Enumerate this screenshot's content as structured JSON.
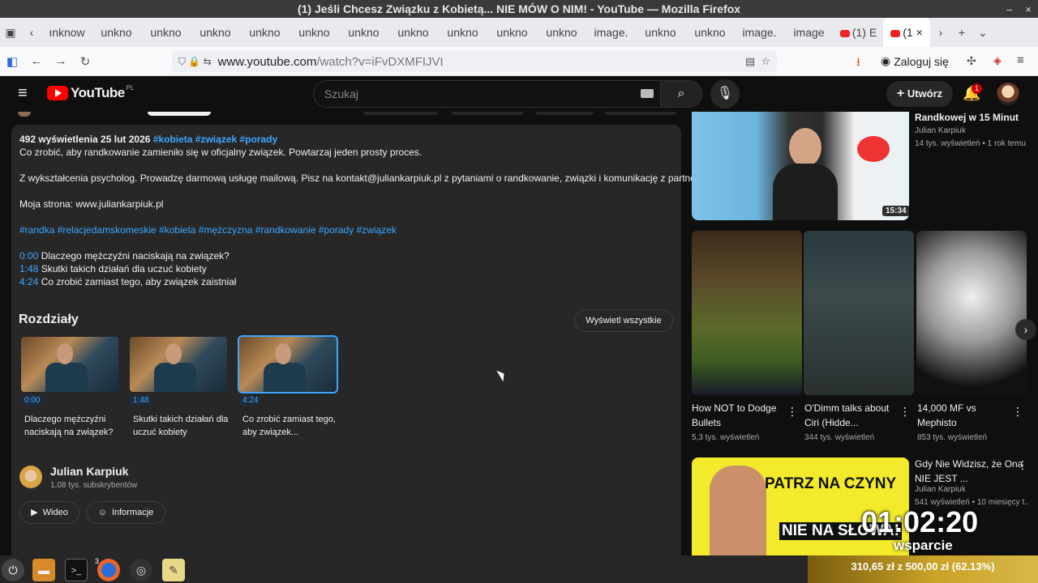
{
  "window": {
    "title": "(1) Jeśli Chcesz Związku z Kobietą... NIE MÓW O NIM! - YouTube — Mozilla Firefox",
    "minimize": "–",
    "close": "×"
  },
  "tabs": [
    "ınknow",
    "unkno",
    "unkno",
    "unkno",
    "unkno",
    "unkno",
    "unkno",
    "unkno",
    "unkno",
    "unkno",
    "unkno",
    "image.",
    "unkno",
    "unkno",
    "image.",
    "image",
    "image",
    "(1) E",
    "(1"
  ],
  "nav": {
    "url_host": "www.youtube.com",
    "url_path": "/watch?v=iFvDXMFIJVI",
    "login_label": "Zaloguj się"
  },
  "yt_header": {
    "logo": "YouTube",
    "region": "PL",
    "search_placeholder": "Szukaj",
    "create_label": "Utwórz",
    "notif_count": "1"
  },
  "description": {
    "stats": "492 wyświetlenia  25 lut 2026",
    "stat_tags": "#kobieta #związek #porady",
    "line1": "Co zrobić, aby randkowanie zamieniło się w oficjalny związek. Powtarzaj jeden prosty proces.",
    "line2": "Z wykształcenia psycholog. Prowadzę darmową usługę mailową. Pisz na kontakt@juliankarpiuk.pl z pytaniami o randkowanie, związki i komunikację z partnerem.",
    "line3": "Moja strona: www.juliankarpiuk.pl",
    "hashtags": "#randka #relacjedamskomeskie #kobieta #mężczyzna #randkowanie #porady #związek",
    "timestamps": [
      {
        "time": "0:00",
        "text": "Dlaczego mężczyźni naciskają na związek?"
      },
      {
        "time": "1:48",
        "text": "Skutki takich działań dla uczuć kobiety"
      },
      {
        "time": "4:24",
        "text": "Co zrobić zamiast tego, aby związek zaistniał"
      }
    ],
    "chapters_heading": "Rozdziały",
    "show_all_label": "Wyświetl wszystkie",
    "chapters": [
      {
        "time": "0:00",
        "title": "Dlaczego mężczyźni naciskają na związek?"
      },
      {
        "time": "1:48",
        "title": "Skutki takich działań dla uczuć kobiety"
      },
      {
        "time": "4:24",
        "title": "Co zrobić zamiast tego, aby związek..."
      }
    ],
    "channel_name": "Julian Karpiuk",
    "channel_subs": "1,08 tys. subskrybentów",
    "video_btn": "Wideo",
    "info_btn": "Informacje"
  },
  "sidebar": {
    "top_video": {
      "title": "Randkowej w 15 Minut",
      "channel": "Julian Karpiuk",
      "meta": "14 tys. wyświetleń • 1 rok temu",
      "duration": "15:34"
    },
    "shorts": [
      {
        "title": "How NOT to Dodge Bullets",
        "meta": "5,3 tys. wyświetleń"
      },
      {
        "title": "O'Dimm talks about Ciri (Hidde...",
        "meta": "344 tys. wyświetleń"
      },
      {
        "title": "14,000 MF vs Mephisto",
        "meta": "853 tys. wyświetleń"
      }
    ],
    "bottom_video": {
      "title": "Gdy Nie Widzisz, że Ona NIE JEST ...",
      "channel": "Julian Karpiuk",
      "meta": "541 wyświetleń • 10 miesięcy t...",
      "thumb_text1": "PATRZ NA CZYNY",
      "thumb_text2": "NIE NA SŁOWA!"
    }
  },
  "overlay": {
    "timer": "01:02:20",
    "timer_sub": "wsparcie",
    "donation": "310,65 zł z 500,00 zł (62.13%)"
  },
  "taskbar": {
    "firefox_badge": "3"
  },
  "colors": {
    "link": "#3ea6ff",
    "yt_red": "#ff0000",
    "panel": "#272727"
  }
}
